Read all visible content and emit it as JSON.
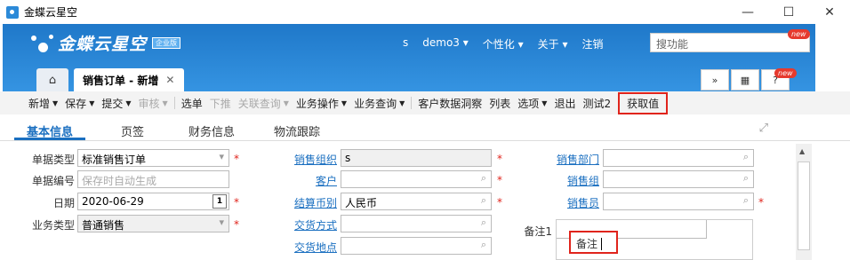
{
  "window": {
    "title": "金蝶云星空",
    "minimize": "—",
    "maximize": "☐",
    "close": "✕"
  },
  "header": {
    "logo": "金蝶云星空",
    "edition": "企业版",
    "nav": [
      "s",
      "demo3 ▾",
      "个性化 ▾",
      "关于 ▾",
      "注销"
    ],
    "search_placeholder": "搜功能",
    "new_badge": "new"
  },
  "tabs": {
    "home": "⌂",
    "active": "销售订单 - 新增",
    "close": "✕",
    "tools": [
      "»",
      "▦",
      "?"
    ]
  },
  "toolbar": [
    {
      "label": "新增",
      "caret": true,
      "dim": false
    },
    {
      "label": "保存",
      "caret": true,
      "dim": false
    },
    {
      "label": "提交",
      "caret": true,
      "dim": false
    },
    {
      "label": "审核",
      "caret": true,
      "dim": true
    },
    {
      "label": "选单",
      "caret": false,
      "dim": false
    },
    {
      "label": "下推",
      "caret": false,
      "dim": true
    },
    {
      "label": "关联查询",
      "caret": true,
      "dim": true
    },
    {
      "label": "业务操作",
      "caret": true,
      "dim": false
    },
    {
      "label": "业务查询",
      "caret": true,
      "dim": false
    },
    {
      "label": "客户数据洞察",
      "caret": false,
      "dim": false
    },
    {
      "label": "列表",
      "caret": false,
      "dim": false
    },
    {
      "label": "选项",
      "caret": true,
      "dim": false
    },
    {
      "label": "退出",
      "caret": false,
      "dim": false
    },
    {
      "label": "测试2",
      "caret": false,
      "dim": false
    },
    {
      "label": "获取值",
      "caret": false,
      "dim": false
    }
  ],
  "subtabs": [
    "基本信息",
    "页签",
    "财务信息",
    "物流跟踪"
  ],
  "form": {
    "doc_type_label": "单据类型",
    "doc_type_value": "标准销售订单",
    "doc_no_label": "单据编号",
    "doc_no_placeholder": "保存时自动生成",
    "date_label": "日期",
    "date_value": "2020-06-29",
    "cal_day": "1",
    "biz_type_label": "业务类型",
    "biz_type_value": "普通销售",
    "sales_org_label": "销售组织",
    "sales_org_value": "s",
    "customer_label": "客户",
    "customer_value": "",
    "currency_label": "结算币别",
    "currency_value": "人民币",
    "delivery_method_label": "交货方式",
    "delivery_method_value": "",
    "delivery_place_label": "交货地点",
    "delivery_place_value": "",
    "sales_dept_label": "销售部门",
    "sales_group_label": "销售组",
    "salesman_label": "销售员",
    "memo1_label": "备注1",
    "memo_popup": "备注"
  }
}
